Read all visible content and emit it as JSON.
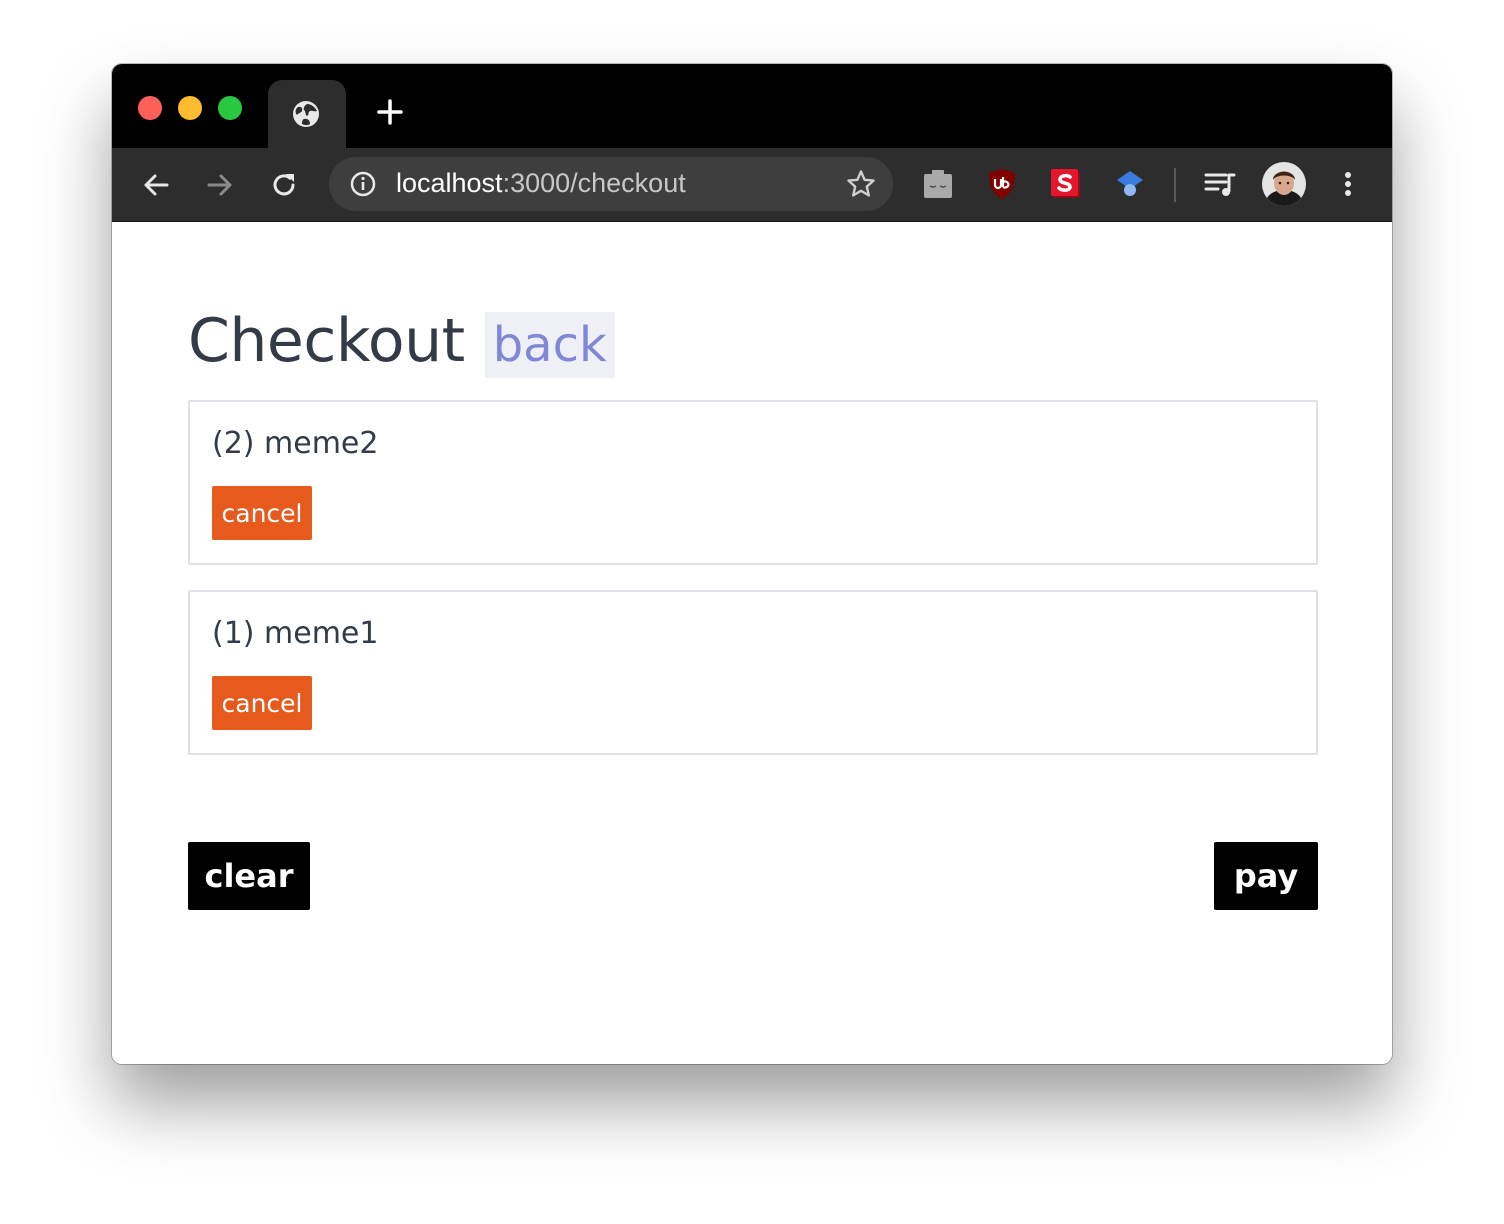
{
  "browser": {
    "url_host": "localhost",
    "url_rest": ":3000/checkout",
    "icons": {
      "traffic": [
        "close-light",
        "minimize-light",
        "maximize-light"
      ],
      "tab": "globe-icon",
      "toolbar": [
        "back-icon",
        "forward-icon",
        "reload-icon",
        "info-icon",
        "star-icon"
      ],
      "extensions": [
        "toggl-icon",
        "ublock-icon",
        "s-extension-icon",
        "blue-extension-icon",
        "media-playlist-icon",
        "menu-kebab-icon"
      ]
    },
    "colors": {
      "red": "#fe5f57",
      "yellow": "#febc2e",
      "green": "#28c840"
    }
  },
  "page": {
    "title": "Checkout",
    "back_label": "back",
    "items": [
      {
        "name": "(2) meme2",
        "cancel_label": "cancel"
      },
      {
        "name": "(1) meme1",
        "cancel_label": "cancel"
      }
    ],
    "clear_label": "clear",
    "pay_label": "pay",
    "colors": {
      "cancel": "#e65a1e",
      "action": "#000000",
      "link": "#7f88d6",
      "text": "#333a48"
    }
  }
}
